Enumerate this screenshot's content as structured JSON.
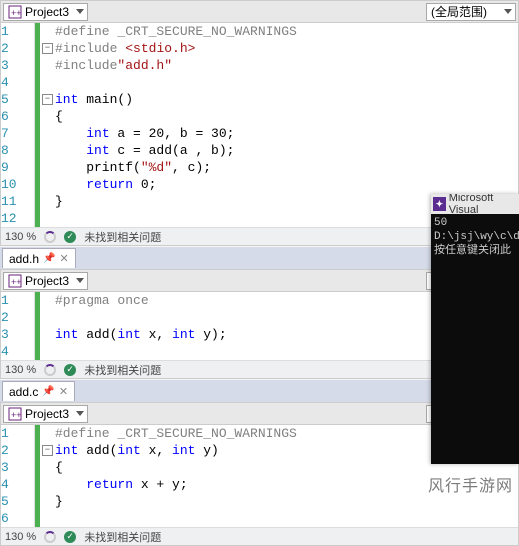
{
  "scope_label": "(全局范围)",
  "project_name": "Project3",
  "zoom": "130 %",
  "no_issues": "未找到相关问题",
  "watermark": "风行手游网",
  "mainc": {
    "lines": [
      {
        "n": 1,
        "toggle": false,
        "html": "<span class='pp'>#define _CRT_SECURE_NO_WARNINGS</span>"
      },
      {
        "n": 2,
        "toggle": true,
        "html": "<span class='pp'>#include</span> <span class='str'>&lt;stdio.h&gt;</span>"
      },
      {
        "n": 3,
        "toggle": false,
        "html": "<span class='pp'>#include</span><span class='str'>\"add.h\"</span>"
      },
      {
        "n": 4,
        "toggle": false,
        "html": ""
      },
      {
        "n": 5,
        "toggle": true,
        "html": "<span class='kw'>int</span> main()"
      },
      {
        "n": 6,
        "toggle": false,
        "html": "{"
      },
      {
        "n": 7,
        "toggle": false,
        "html": "    <span class='kw'>int</span> a = 20, b = 30;"
      },
      {
        "n": 8,
        "toggle": false,
        "html": "    <span class='kw'>int</span> c = add(a , b);"
      },
      {
        "n": 9,
        "toggle": false,
        "html": "    printf(<span class='str'>\"%d\"</span>, c);"
      },
      {
        "n": 10,
        "toggle": false,
        "html": "    <span class='kw'>return</span> 0;"
      },
      {
        "n": 11,
        "toggle": false,
        "html": "}"
      },
      {
        "n": 12,
        "toggle": false,
        "html": ""
      }
    ]
  },
  "addh": {
    "tab": "add.h",
    "lines": [
      {
        "n": 1,
        "toggle": false,
        "html": "<span class='pp'>#pragma once</span>"
      },
      {
        "n": 2,
        "toggle": false,
        "html": ""
      },
      {
        "n": 3,
        "toggle": false,
        "html": "<span class='kw'>int</span> add(<span class='kw'>int</span> x, <span class='kw'>int</span> y);"
      },
      {
        "n": 4,
        "toggle": false,
        "html": ""
      }
    ]
  },
  "addc": {
    "tab": "add.c",
    "lines": [
      {
        "n": 1,
        "toggle": false,
        "html": "<span class='pp'>#define _CRT_SECURE_NO_WARNINGS</span>"
      },
      {
        "n": 2,
        "toggle": true,
        "html": "<span class='kw'>int</span> add(<span class='kw'>int</span> x, <span class='kw'>int</span> y)"
      },
      {
        "n": 3,
        "toggle": false,
        "html": "{"
      },
      {
        "n": 4,
        "toggle": false,
        "html": "    <span class='kw'>return</span> x + y;"
      },
      {
        "n": 5,
        "toggle": false,
        "html": "}"
      },
      {
        "n": 6,
        "toggle": false,
        "html": ""
      }
    ]
  },
  "console": {
    "title": "Microsoft Visual",
    "out_value": "50",
    "path": "D:\\jsj\\wy\\c\\dm",
    "prompt": "按任意键关闭此"
  }
}
